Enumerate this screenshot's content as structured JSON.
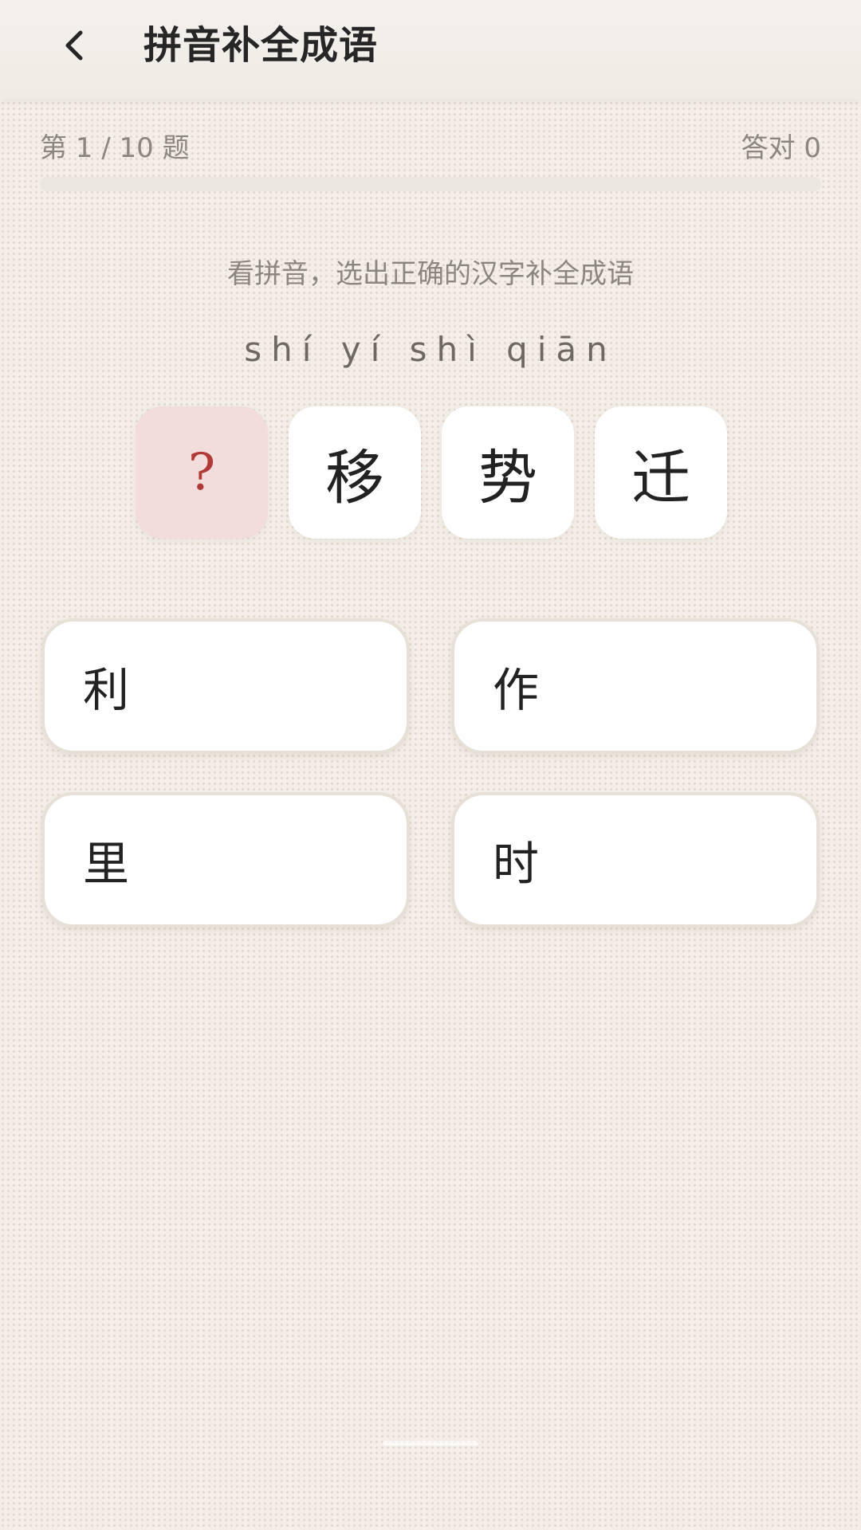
{
  "header": {
    "title": "拼音补全成语",
    "back_icon": "chevron-left-icon"
  },
  "quiz": {
    "progress_text": "第 1 / 10 题",
    "score_text": "答对 0",
    "progress_fraction": 0.0,
    "instruction": "看拼音，选出正确的汉字补全成语",
    "pinyin": "shí yí shì qiān",
    "tiles": [
      {
        "char": "?",
        "blank": true
      },
      {
        "char": "移",
        "blank": false
      },
      {
        "char": "势",
        "blank": false
      },
      {
        "char": "迁",
        "blank": false
      }
    ]
  },
  "options": [
    "利",
    "作",
    "里",
    "时"
  ],
  "colors": {
    "accent": "#b03a36",
    "blank_tile_bg": "#f2dcdc",
    "background": "#f3efe8"
  }
}
